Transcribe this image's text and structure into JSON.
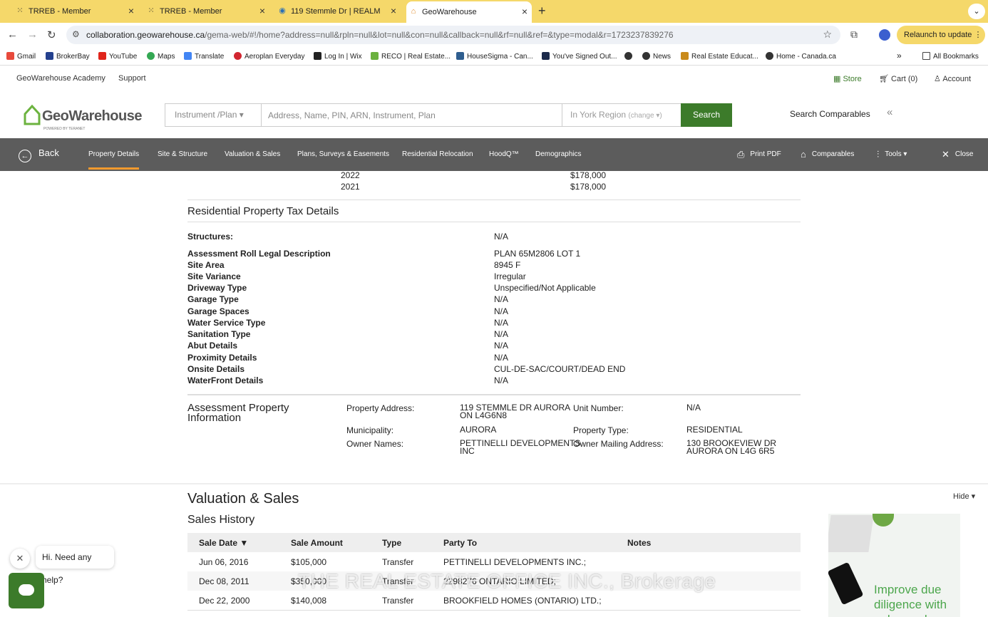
{
  "browser": {
    "tabs": [
      {
        "label": "TRREB - Member",
        "icon": "trreb-icon"
      },
      {
        "label": "TRREB - Member",
        "icon": "trreb-icon"
      },
      {
        "label": "119 Stemmle Dr | REALM",
        "icon": "realm-icon"
      },
      {
        "label": "GeoWarehouse",
        "icon": "geowarehouse-icon",
        "active": true
      }
    ],
    "url_host": "collaboration.geowarehouse.ca",
    "url_rest": "/gema-web/#!/home?address=null&rpln=null&lot=null&con=null&callback=null&rf=null&ref=&type=modal&r=1723237839276",
    "relaunch_label": "Relaunch to update",
    "bookmarks": [
      "Gmail",
      "BrokerBay",
      "YouTube",
      "Maps",
      "Translate",
      "Aeroplan Everyday",
      "Log In | Wix",
      "RECO | Real Estate...",
      "HouseSigma - Can...",
      "You've Signed Out...",
      "",
      "News",
      "Real Estate Educat...",
      "Home - Canada.ca"
    ],
    "all_bookmarks": "All Bookmarks",
    "accent_color": "#f5d86a"
  },
  "utility": {
    "academy": "GeoWarehouse Academy",
    "support": "Support",
    "store": "Store",
    "cart": "Cart (0)",
    "account": "Account"
  },
  "header": {
    "logo_text": "GeoWarehouse",
    "logo_tagline": "POWERED BY TERANET",
    "search_type": "Instrument /Plan",
    "search_placeholder": "Address, Name, PIN, ARN, Instrument, Plan",
    "region": "In York Region",
    "region_change": "(change ▾)",
    "search_button": "Search",
    "search_comparables": "Search Comparables",
    "brand_color": "#3c7b2a"
  },
  "nav": {
    "back": "Back",
    "items": [
      "Property Details",
      "Site & Structure",
      "Valuation & Sales",
      "Plans, Surveys & Easements",
      "Residential Relocation",
      "HoodQ™",
      "Demographics"
    ],
    "active_index": 0,
    "print_pdf": "Print PDF",
    "comparables": "Comparables",
    "tools": "Tools ▾",
    "close": "Close"
  },
  "assessment_years": [
    {
      "year": "2022",
      "value": "$178,000"
    },
    {
      "year": "2021",
      "value": "$178,000"
    }
  ],
  "tax_details": {
    "title": "Residential Property Tax Details",
    "structures_label": "Structures:",
    "structures_value": "N/A",
    "rows": [
      {
        "label": "Assessment Roll Legal Description",
        "value": "PLAN 65M2806 LOT 1"
      },
      {
        "label": "Site Area",
        "value": "8945 F"
      },
      {
        "label": "Site Variance",
        "value": "Irregular"
      },
      {
        "label": "Driveway Type",
        "value": "Unspecified/Not Applicable"
      },
      {
        "label": "Garage Type",
        "value": "N/A"
      },
      {
        "label": "Garage Spaces",
        "value": "N/A"
      },
      {
        "label": "Water Service Type",
        "value": "N/A"
      },
      {
        "label": "Sanitation Type",
        "value": "N/A"
      },
      {
        "label": "Abut Details",
        "value": "N/A"
      },
      {
        "label": "Proximity Details",
        "value": "N/A"
      },
      {
        "label": "Onsite Details",
        "value": "CUL-DE-SAC/COURT/DEAD END"
      },
      {
        "label": "WaterFront Details",
        "value": "N/A"
      }
    ]
  },
  "assessment_property": {
    "title_line1": "Assessment Property",
    "title_line2": "Information",
    "property_address_label": "Property Address:",
    "property_address_line1": "119 STEMMLE DR AURORA",
    "property_address_line2": "ON L4G6N8",
    "unit_number_label": "Unit Number:",
    "unit_number": "N/A",
    "municipality_label": "Municipality:",
    "municipality": "AURORA",
    "property_type_label": "Property Type:",
    "property_type": "RESIDENTIAL",
    "owner_names_label": "Owner Names:",
    "owner_names_line1": "PETTINELLI DEVELOPMENTS",
    "owner_names_line2": "INC",
    "owner_mailing_label": "Owner Mailing Address:",
    "owner_mailing_line1": "130 BROOKEVIEW DR",
    "owner_mailing_line2": "AURORA ON L4G 6R5"
  },
  "valuation": {
    "title": "Valuation & Sales",
    "hide": "Hide ▾",
    "sales_history_title": "Sales History",
    "columns": [
      "Sale Date ▼",
      "Sale Amount",
      "Type",
      "Party To",
      "Notes"
    ],
    "rows": [
      {
        "date": "Jun 06, 2016",
        "amount": "$105,000",
        "type": "Transfer",
        "party": "PETTINELLI DEVELOPMENTS INC.;",
        "notes": ""
      },
      {
        "date": "Dec 08, 2011",
        "amount": "$350,000",
        "type": "Transfer",
        "party": "2298276 ONTARIO LIMITED;",
        "notes": ""
      },
      {
        "date": "Dec 22, 2000",
        "amount": "$140,008",
        "type": "Transfer",
        "party": "BROOKFIELD HOMES (ONTARIO) LTD.;",
        "notes": ""
      }
    ]
  },
  "watermark": "THE REAL ESTATE OFFICE INC., Brokerage",
  "ad": {
    "line1": "Improve due",
    "line2": "diligence with",
    "line3": "enhanced"
  },
  "chat": {
    "prompt": "Hi. Need any help?"
  }
}
